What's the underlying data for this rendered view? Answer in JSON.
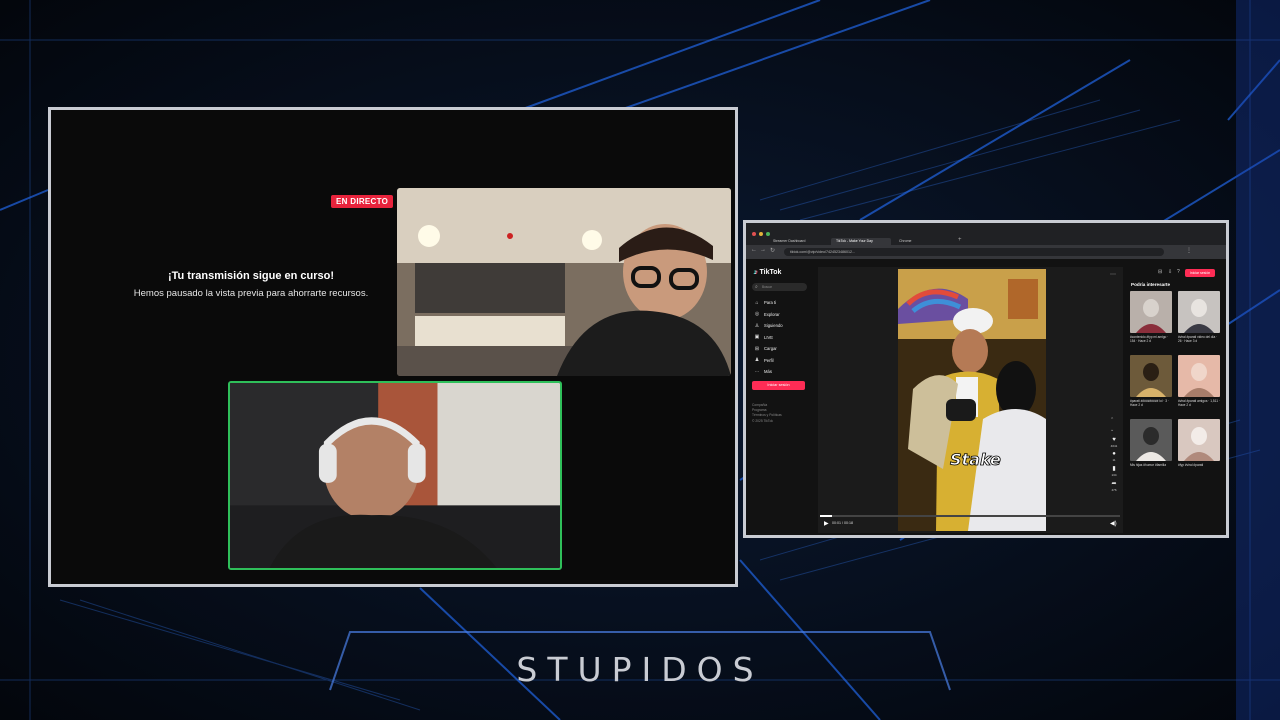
{
  "stream": {
    "live_badge": "EN DIRECTO",
    "notice_title": "¡Tu transmisión sigue en curso!",
    "notice_subtitle": "Hemos pausado la vista previa para ahorrarte recursos."
  },
  "browser": {
    "tabs": [
      "Streamer Dashboard",
      "TikTok - Make Your Day",
      "Chrome"
    ],
    "address_url": "tiktok.com/@vip/video/7424523486012...",
    "tiktok": {
      "brand": "TikTok",
      "search_placeholder": "Buscar",
      "nav": [
        {
          "label": "Para ti",
          "icon": "home-icon"
        },
        {
          "label": "Explorar",
          "icon": "compass-icon"
        },
        {
          "label": "Siguiendo",
          "icon": "users-icon"
        },
        {
          "label": "LIVE",
          "icon": "live-icon"
        },
        {
          "label": "Cargar",
          "icon": "upload-icon"
        },
        {
          "label": "Perfil",
          "icon": "profile-icon"
        },
        {
          "label": "Más",
          "icon": "more-icon"
        }
      ],
      "login_button": "Iniciar sesión",
      "footer_links": [
        "Compañía",
        "Programa",
        "Términos y Políticas",
        "© 2025 TikTok"
      ],
      "video_time": "00:01 / 00:18",
      "video_overlay_text": "Stake",
      "action_counts": [
        "4041",
        "11",
        "134",
        "476"
      ],
      "right_panel_title": "Podría interesarte",
      "right_panel_login": "Iniciar sesión",
      "thumbnails": [
        {
          "caption": "#contenido #fyp mi amigo · 154 · Hace 2 d",
          "palette": [
            "#b9b0aa",
            "#8a2e3b",
            "#d8d2cc"
          ]
        },
        {
          "caption": "#viral #parati video del día · 26 · Hace 3 d",
          "palette": [
            "#c7c3c0",
            "#3a3a44",
            "#e8e4e0"
          ]
        },
        {
          "caption": "#parati ########## lol · 3 · Hace 2 d",
          "palette": [
            "#6d5a3a",
            "#d8b26a",
            "#2a1f14"
          ]
        },
        {
          "caption": "#viral #parati amigos · 1,511 · Hace 2 d",
          "palette": [
            "#e6b9a8",
            "#a87d6a",
            "#f0d6ca"
          ]
        },
        {
          "caption": "Mis hijas #humor #familia",
          "palette": [
            "#5a5a5a",
            "#ece8e4",
            "#2b2b2b"
          ]
        },
        {
          "caption": "#fyp #viral #parati",
          "palette": [
            "#d9c8c0",
            "#b08a7c",
            "#f3ece8"
          ]
        }
      ]
    }
  },
  "footer_title": "STUPIDOS"
}
